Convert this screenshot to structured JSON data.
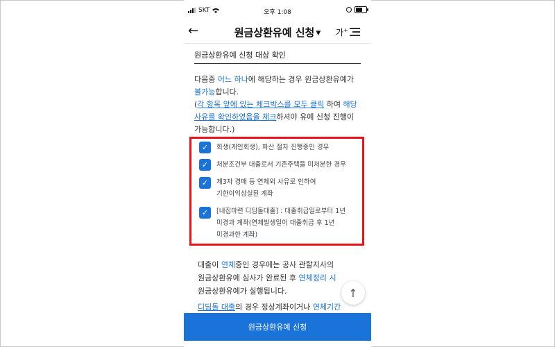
{
  "status_bar": {
    "carrier": "SKT",
    "time": "오후 1:08"
  },
  "header": {
    "title": "원금상환유예 신청",
    "font_size_label": "가",
    "font_size_sup": "+"
  },
  "section_title": "원금상환유예 신청 대상 확인",
  "intro": {
    "p1": "다음중 ",
    "p1_hl": "어느 하나",
    "p2": "에 해당하는 경우 원금상환유예가",
    "p3_hl": "불가능",
    "p3": "합니다.",
    "p4": "(",
    "p4_link": "각 항목 앞에 있는 체크박스를 모두 클릭",
    "p5": " 하여 ",
    "p5_hl": "해당",
    "p6_link": "사유를 확인하였음을 체크",
    "p7": "하셔야 유예 신청 진행이",
    "p8": "가능합니다.)"
  },
  "checklist": [
    {
      "line1": "회생(개인회생), 파산 절차 진행중인 경우",
      "line2": "",
      "line3": ""
    },
    {
      "line1": "처분조건부 대출로서 기존주택을 미처분한 경우",
      "line2": "",
      "line3": ""
    },
    {
      "line1": "제3자 경매 등 연체외 사유로 인하여",
      "line2": "기한이익상실된 계좌",
      "line3": ""
    },
    {
      "line1": "[내집마련 디딤돌대출] : 대출취급일로부터 1년",
      "line2": "미경과 계좌(연체발생일이 대출취급 후 1년",
      "line3": "미경과한 계좌)"
    }
  ],
  "lower": {
    "a1": "대출이 ",
    "a1_hl": "연체",
    "a2": "중인 경우에는 공사 관할지사의",
    "a3": "원금상환유예 심사가 완료된 후 ",
    "a3_hl": "연체정리 시",
    "a4": "원금상환유예가 실행됩니다.",
    "b1_hl": "디딤돌 대출",
    "b2": "의 경우 정상계좌이거나 ",
    "b2_hl": "연체기간"
  },
  "cta_label": "원금상환유예 신청",
  "colors": {
    "accent": "#1a73d9",
    "highlight_box": "#e8141c"
  },
  "icons": [
    "back-arrow-icon",
    "dropdown-caret-icon",
    "menu-icon",
    "check-icon",
    "arrow-up-icon",
    "wifi-icon",
    "battery-icon"
  ]
}
